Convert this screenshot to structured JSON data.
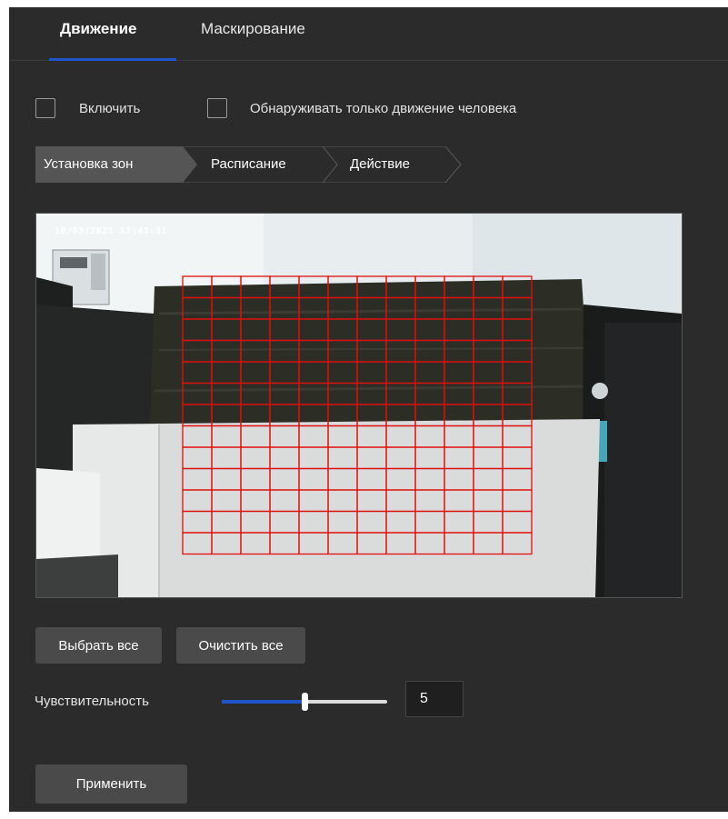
{
  "tabs": [
    {
      "label": "Движение",
      "active": true
    },
    {
      "label": "Маскирование",
      "active": false
    }
  ],
  "options": {
    "enable_label": "Включить",
    "enable_checked": false,
    "human_only_label": "Обнаруживать только движение человека",
    "human_only_checked": false
  },
  "steps": [
    {
      "label": "Установка зон",
      "active": true
    },
    {
      "label": "Расписание",
      "active": false
    },
    {
      "label": "Действие",
      "active": false
    }
  ],
  "video": {
    "timestamp": "10/03/2025 17:43:31",
    "grid_color": "#e01010",
    "grid": {
      "cols": 12,
      "rows": 13
    }
  },
  "buttons": {
    "select_all": "Выбрать все",
    "clear_all": "Очистить все",
    "apply": "Применить"
  },
  "sensitivity": {
    "label": "Чувствительность",
    "value": "5",
    "slider_fraction": 0.5
  },
  "colors": {
    "panel_bg": "#2b2b2b",
    "accent": "#1e55c8",
    "button_bg": "#4a4a4a"
  }
}
